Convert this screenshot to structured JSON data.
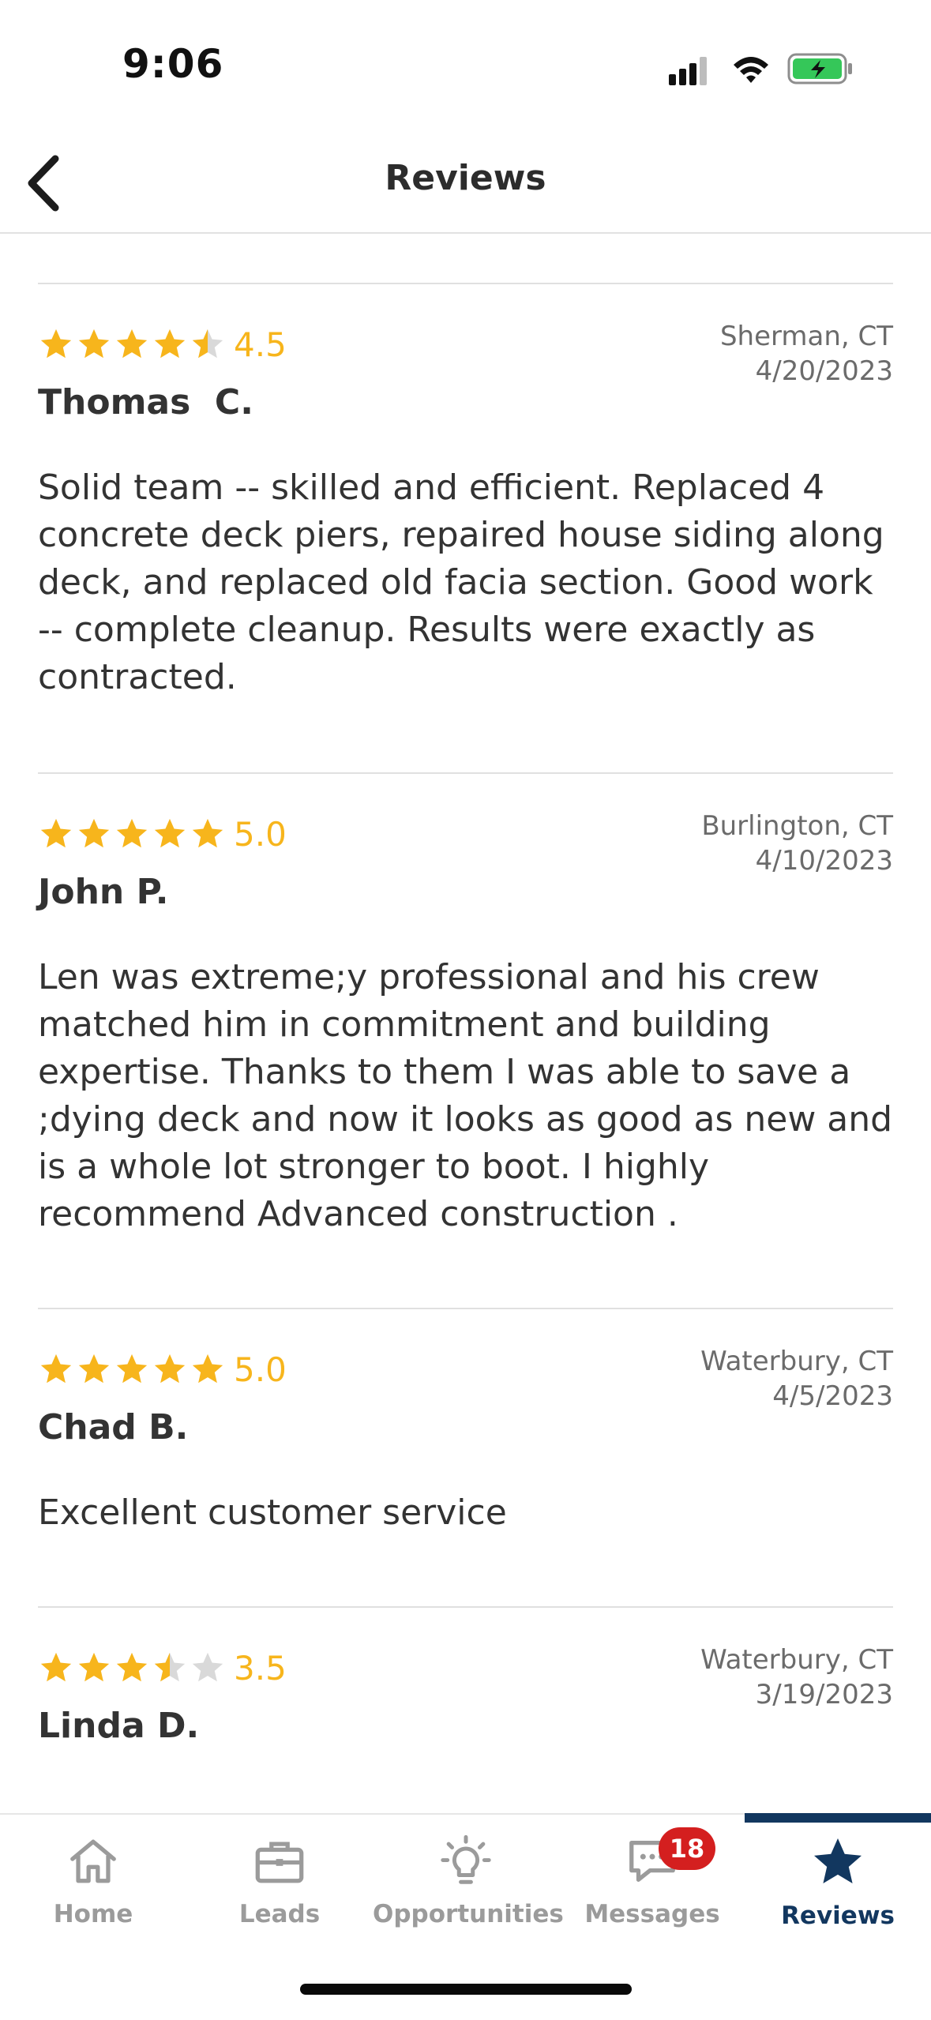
{
  "status_bar": {
    "time": "9:06"
  },
  "nav": {
    "title": "Reviews"
  },
  "colors": {
    "star": "#f7b51c",
    "star_empty": "#d9d9d9",
    "active_tab": "#12375f",
    "badge": "#d41f1f"
  },
  "reviews": [
    {
      "rating": 4.5,
      "rating_label": "4.5",
      "location": "Sherman, CT",
      "date": "4/20/2023",
      "name": "Thomas  C.",
      "text": "Solid team -- skilled and efficient.  Replaced 4 concrete deck piers, repaired house siding along deck, and replaced old facia section.  Good work -- complete cleanup.  Results were exactly as contracted."
    },
    {
      "rating": 5.0,
      "rating_label": "5.0",
      "location": "Burlington, CT",
      "date": "4/10/2023",
      "name": "John P.",
      "text": "Len was extreme;y professional and his crew matched him in commitment and building expertise. Thanks to them I was able to save a ;dying deck and now it looks as good as new and is a whole lot stronger to boot. I highly recommend Advanced construction ."
    },
    {
      "rating": 5.0,
      "rating_label": "5.0",
      "location": "Waterbury, CT",
      "date": "4/5/2023",
      "name": "Chad B.",
      "text": "Excellent customer service"
    },
    {
      "rating": 3.5,
      "rating_label": "3.5",
      "location": "Waterbury, CT",
      "date": "3/19/2023",
      "name": "Linda D.",
      "text": ""
    }
  ],
  "tabs": [
    {
      "label": "Home",
      "icon": "home-icon"
    },
    {
      "label": "Leads",
      "icon": "briefcase-icon"
    },
    {
      "label": "Opportunities",
      "icon": "lightbulb-icon"
    },
    {
      "label": "Messages",
      "icon": "chat-icon",
      "badge": "18"
    },
    {
      "label": "Reviews",
      "icon": "star-icon",
      "active": true
    }
  ]
}
